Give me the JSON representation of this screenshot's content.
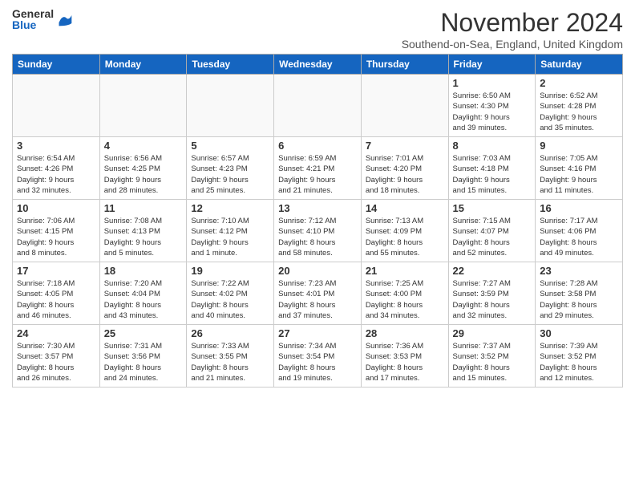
{
  "header": {
    "logo_general": "General",
    "logo_blue": "Blue",
    "title": "November 2024",
    "location": "Southend-on-Sea, England, United Kingdom"
  },
  "days_of_week": [
    "Sunday",
    "Monday",
    "Tuesday",
    "Wednesday",
    "Thursday",
    "Friday",
    "Saturday"
  ],
  "weeks": [
    [
      {
        "num": "",
        "info": "",
        "empty": true
      },
      {
        "num": "",
        "info": "",
        "empty": true
      },
      {
        "num": "",
        "info": "",
        "empty": true
      },
      {
        "num": "",
        "info": "",
        "empty": true
      },
      {
        "num": "",
        "info": "",
        "empty": true
      },
      {
        "num": "1",
        "info": "Sunrise: 6:50 AM\nSunset: 4:30 PM\nDaylight: 9 hours\nand 39 minutes.",
        "empty": false
      },
      {
        "num": "2",
        "info": "Sunrise: 6:52 AM\nSunset: 4:28 PM\nDaylight: 9 hours\nand 35 minutes.",
        "empty": false
      }
    ],
    [
      {
        "num": "3",
        "info": "Sunrise: 6:54 AM\nSunset: 4:26 PM\nDaylight: 9 hours\nand 32 minutes.",
        "empty": false
      },
      {
        "num": "4",
        "info": "Sunrise: 6:56 AM\nSunset: 4:25 PM\nDaylight: 9 hours\nand 28 minutes.",
        "empty": false
      },
      {
        "num": "5",
        "info": "Sunrise: 6:57 AM\nSunset: 4:23 PM\nDaylight: 9 hours\nand 25 minutes.",
        "empty": false
      },
      {
        "num": "6",
        "info": "Sunrise: 6:59 AM\nSunset: 4:21 PM\nDaylight: 9 hours\nand 21 minutes.",
        "empty": false
      },
      {
        "num": "7",
        "info": "Sunrise: 7:01 AM\nSunset: 4:20 PM\nDaylight: 9 hours\nand 18 minutes.",
        "empty": false
      },
      {
        "num": "8",
        "info": "Sunrise: 7:03 AM\nSunset: 4:18 PM\nDaylight: 9 hours\nand 15 minutes.",
        "empty": false
      },
      {
        "num": "9",
        "info": "Sunrise: 7:05 AM\nSunset: 4:16 PM\nDaylight: 9 hours\nand 11 minutes.",
        "empty": false
      }
    ],
    [
      {
        "num": "10",
        "info": "Sunrise: 7:06 AM\nSunset: 4:15 PM\nDaylight: 9 hours\nand 8 minutes.",
        "empty": false
      },
      {
        "num": "11",
        "info": "Sunrise: 7:08 AM\nSunset: 4:13 PM\nDaylight: 9 hours\nand 5 minutes.",
        "empty": false
      },
      {
        "num": "12",
        "info": "Sunrise: 7:10 AM\nSunset: 4:12 PM\nDaylight: 9 hours\nand 1 minute.",
        "empty": false
      },
      {
        "num": "13",
        "info": "Sunrise: 7:12 AM\nSunset: 4:10 PM\nDaylight: 8 hours\nand 58 minutes.",
        "empty": false
      },
      {
        "num": "14",
        "info": "Sunrise: 7:13 AM\nSunset: 4:09 PM\nDaylight: 8 hours\nand 55 minutes.",
        "empty": false
      },
      {
        "num": "15",
        "info": "Sunrise: 7:15 AM\nSunset: 4:07 PM\nDaylight: 8 hours\nand 52 minutes.",
        "empty": false
      },
      {
        "num": "16",
        "info": "Sunrise: 7:17 AM\nSunset: 4:06 PM\nDaylight: 8 hours\nand 49 minutes.",
        "empty": false
      }
    ],
    [
      {
        "num": "17",
        "info": "Sunrise: 7:18 AM\nSunset: 4:05 PM\nDaylight: 8 hours\nand 46 minutes.",
        "empty": false
      },
      {
        "num": "18",
        "info": "Sunrise: 7:20 AM\nSunset: 4:04 PM\nDaylight: 8 hours\nand 43 minutes.",
        "empty": false
      },
      {
        "num": "19",
        "info": "Sunrise: 7:22 AM\nSunset: 4:02 PM\nDaylight: 8 hours\nand 40 minutes.",
        "empty": false
      },
      {
        "num": "20",
        "info": "Sunrise: 7:23 AM\nSunset: 4:01 PM\nDaylight: 8 hours\nand 37 minutes.",
        "empty": false
      },
      {
        "num": "21",
        "info": "Sunrise: 7:25 AM\nSunset: 4:00 PM\nDaylight: 8 hours\nand 34 minutes.",
        "empty": false
      },
      {
        "num": "22",
        "info": "Sunrise: 7:27 AM\nSunset: 3:59 PM\nDaylight: 8 hours\nand 32 minutes.",
        "empty": false
      },
      {
        "num": "23",
        "info": "Sunrise: 7:28 AM\nSunset: 3:58 PM\nDaylight: 8 hours\nand 29 minutes.",
        "empty": false
      }
    ],
    [
      {
        "num": "24",
        "info": "Sunrise: 7:30 AM\nSunset: 3:57 PM\nDaylight: 8 hours\nand 26 minutes.",
        "empty": false
      },
      {
        "num": "25",
        "info": "Sunrise: 7:31 AM\nSunset: 3:56 PM\nDaylight: 8 hours\nand 24 minutes.",
        "empty": false
      },
      {
        "num": "26",
        "info": "Sunrise: 7:33 AM\nSunset: 3:55 PM\nDaylight: 8 hours\nand 21 minutes.",
        "empty": false
      },
      {
        "num": "27",
        "info": "Sunrise: 7:34 AM\nSunset: 3:54 PM\nDaylight: 8 hours\nand 19 minutes.",
        "empty": false
      },
      {
        "num": "28",
        "info": "Sunrise: 7:36 AM\nSunset: 3:53 PM\nDaylight: 8 hours\nand 17 minutes.",
        "empty": false
      },
      {
        "num": "29",
        "info": "Sunrise: 7:37 AM\nSunset: 3:52 PM\nDaylight: 8 hours\nand 15 minutes.",
        "empty": false
      },
      {
        "num": "30",
        "info": "Sunrise: 7:39 AM\nSunset: 3:52 PM\nDaylight: 8 hours\nand 12 minutes.",
        "empty": false
      }
    ]
  ]
}
